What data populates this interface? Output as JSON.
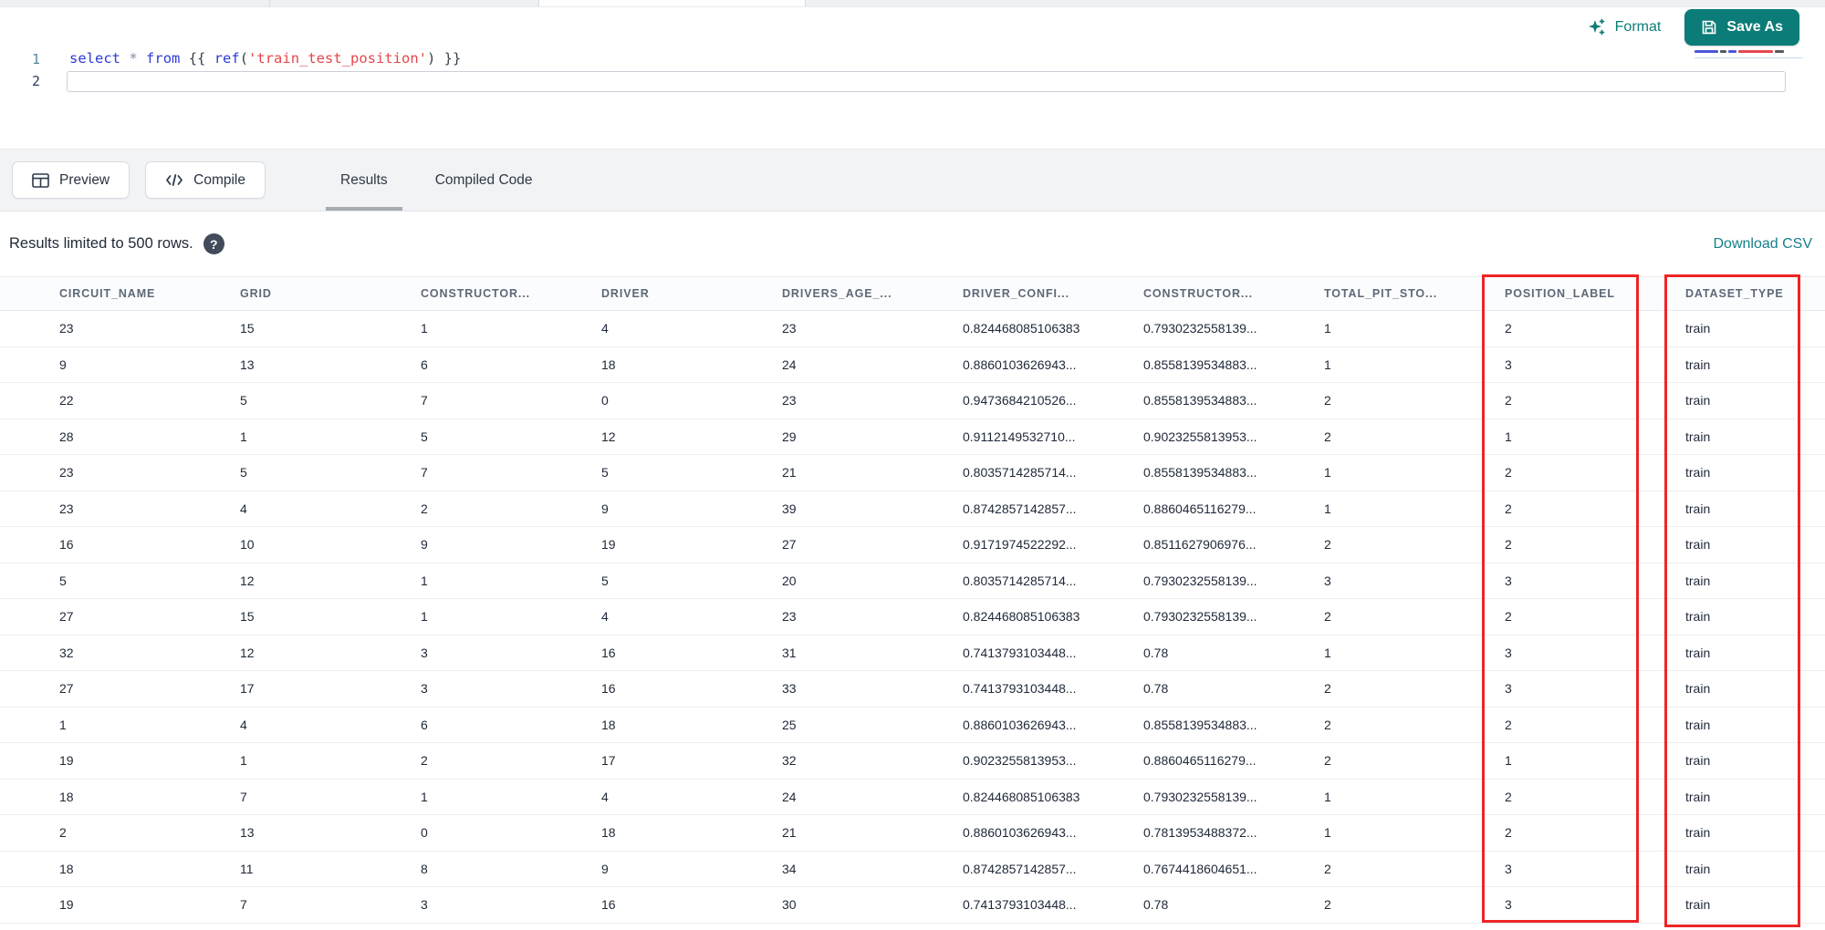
{
  "toolbar_top": {
    "format_label": "Format",
    "save_as_label": "Save As"
  },
  "editor": {
    "line_numbers": [
      "1",
      "2"
    ],
    "code_tokens": [
      {
        "text": "select",
        "type": "keyword"
      },
      {
        "text": " ",
        "type": "plain"
      },
      {
        "text": "*",
        "type": "operator"
      },
      {
        "text": " ",
        "type": "plain"
      },
      {
        "text": "from",
        "type": "keyword"
      },
      {
        "text": " {{ ",
        "type": "plain"
      },
      {
        "text": "ref",
        "type": "keyword"
      },
      {
        "text": "(",
        "type": "plain"
      },
      {
        "text": "'train_test_position'",
        "type": "string"
      },
      {
        "text": ") }}",
        "type": "plain"
      }
    ]
  },
  "actions": {
    "preview_label": "Preview",
    "compile_label": "Compile"
  },
  "tabs": [
    {
      "label": "Results",
      "active": true
    },
    {
      "label": "Compiled Code",
      "active": false
    }
  ],
  "results": {
    "limit_note": "Results limited to 500 rows.",
    "help_glyph": "?",
    "download_csv_label": "Download CSV"
  },
  "table": {
    "columns": [
      "CIRCUIT_NAME",
      "GRID",
      "CONSTRUCTOR...",
      "DRIVER",
      "DRIVERS_AGE_...",
      "DRIVER_CONFI...",
      "CONSTRUCTOR...",
      "TOTAL_PIT_STO...",
      "POSITION_LABEL",
      "DATASET_TYPE"
    ],
    "rows": [
      [
        "23",
        "15",
        "1",
        "4",
        "23",
        "0.824468085106383",
        "0.7930232558139...",
        "1",
        "2",
        "train"
      ],
      [
        "9",
        "13",
        "6",
        "18",
        "24",
        "0.8860103626943...",
        "0.8558139534883...",
        "1",
        "3",
        "train"
      ],
      [
        "22",
        "5",
        "7",
        "0",
        "23",
        "0.9473684210526...",
        "0.8558139534883...",
        "2",
        "2",
        "train"
      ],
      [
        "28",
        "1",
        "5",
        "12",
        "29",
        "0.9112149532710...",
        "0.9023255813953...",
        "2",
        "1",
        "train"
      ],
      [
        "23",
        "5",
        "7",
        "5",
        "21",
        "0.8035714285714...",
        "0.8558139534883...",
        "1",
        "2",
        "train"
      ],
      [
        "23",
        "4",
        "2",
        "9",
        "39",
        "0.8742857142857...",
        "0.8860465116279...",
        "1",
        "2",
        "train"
      ],
      [
        "16",
        "10",
        "9",
        "19",
        "27",
        "0.9171974522292...",
        "0.8511627906976...",
        "2",
        "2",
        "train"
      ],
      [
        "5",
        "12",
        "1",
        "5",
        "20",
        "0.8035714285714...",
        "0.7930232558139...",
        "3",
        "3",
        "train"
      ],
      [
        "27",
        "15",
        "1",
        "4",
        "23",
        "0.824468085106383",
        "0.7930232558139...",
        "2",
        "2",
        "train"
      ],
      [
        "32",
        "12",
        "3",
        "16",
        "31",
        "0.7413793103448...",
        "0.78",
        "1",
        "3",
        "train"
      ],
      [
        "27",
        "17",
        "3",
        "16",
        "33",
        "0.7413793103448...",
        "0.78",
        "2",
        "3",
        "train"
      ],
      [
        "1",
        "4",
        "6",
        "18",
        "25",
        "0.8860103626943...",
        "0.8558139534883...",
        "2",
        "2",
        "train"
      ],
      [
        "19",
        "1",
        "2",
        "17",
        "32",
        "0.9023255813953...",
        "0.8860465116279...",
        "2",
        "1",
        "train"
      ],
      [
        "18",
        "7",
        "1",
        "4",
        "24",
        "0.824468085106383",
        "0.7930232558139...",
        "1",
        "2",
        "train"
      ],
      [
        "2",
        "13",
        "0",
        "18",
        "21",
        "0.8860103626943...",
        "0.7813953488372...",
        "1",
        "2",
        "train"
      ],
      [
        "18",
        "11",
        "8",
        "9",
        "34",
        "0.8742857142857...",
        "0.7674418604651...",
        "2",
        "3",
        "train"
      ],
      [
        "19",
        "7",
        "3",
        "16",
        "30",
        "0.7413793103448...",
        "0.78",
        "2",
        "3",
        "train"
      ]
    ]
  },
  "annotations": {
    "highlight_color": "#ee2426",
    "highlighted_columns": [
      "POSITION_LABEL",
      "DATASET_TYPE"
    ]
  },
  "colors": {
    "accent_teal": "#0b7c78",
    "link_teal": "#157f8b",
    "keyword_blue": "#2d3bd8",
    "string_red": "#e5484d",
    "toolbar_gray": "#f2f3f5"
  }
}
